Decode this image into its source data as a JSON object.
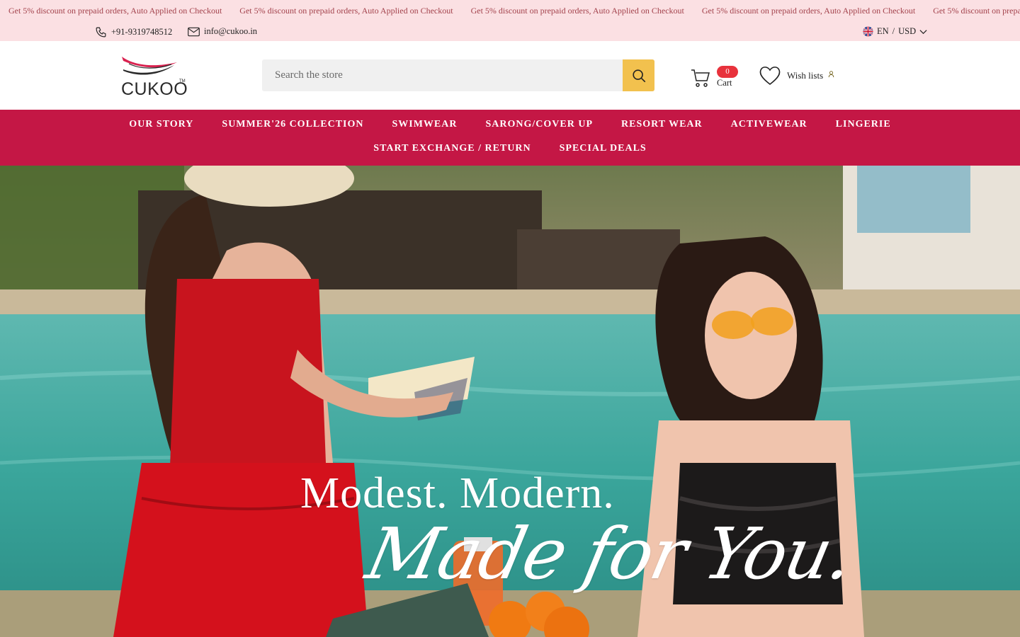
{
  "announcement": {
    "messages": [
      "Get 5% discount on prepaid orders, Auto Applied on Checkout",
      "Get 5% discount on prepaid orders, Auto Applied on Checkout",
      "Get 5% discount on prepaid orders, Auto Applied on Checkout",
      "Get 5% discount on prepaid orders, Auto Applied on Checkout",
      "Get 5% discount on prepa"
    ]
  },
  "contact": {
    "phone": "+91-9319748512",
    "email": "info@cukoo.in"
  },
  "locale": {
    "language": "EN",
    "separator": "/",
    "currency": "USD"
  },
  "brand": {
    "name": "CUKOO",
    "tm": "TM"
  },
  "search": {
    "placeholder": "Search the store"
  },
  "cart": {
    "count": "0",
    "label": "Cart"
  },
  "wishlist": {
    "label": "Wish lists"
  },
  "nav": {
    "row1": [
      "OUR STORY",
      "SUMMER'26 COLLECTION",
      "SWIMWEAR",
      "SARONG/COVER UP",
      "RESORT WEAR",
      "ACTIVEWEAR",
      "LINGERIE"
    ],
    "row2": [
      "START EXCHANGE / RETURN",
      "SPECIAL DEALS"
    ]
  },
  "hero": {
    "line1": "Modest. Modern.",
    "line2": "Made for You."
  },
  "colors": {
    "announce_bg": "#fbe0e3",
    "nav_bg": "#c41745",
    "search_button": "#f2c14e",
    "cart_badge": "#e8323c"
  }
}
